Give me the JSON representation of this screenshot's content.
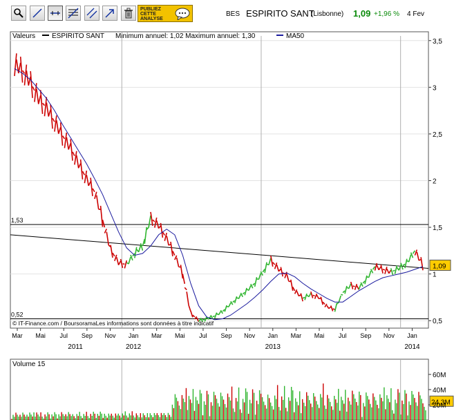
{
  "toolbar": {
    "tools": [
      "zoom-tool",
      "draw-line-tool",
      "horizontal-line-tool",
      "fibonacci-tool",
      "parallel-lines-tool",
      "arrow-tool",
      "delete-tool"
    ],
    "publish_label": "PUBLIEZ\nCETTE\nANALYSE"
  },
  "quote": {
    "ticker": "BES",
    "name": "ESPIRITO SANT",
    "market": "(Lisbonne)",
    "price": "1,09",
    "change": "+1,96 %",
    "date": "4 Fev",
    "change_color": "#0a8a0a"
  },
  "chart_data": {
    "type": "line",
    "legend_items": [
      "Valeurs",
      "ESPIRITO SANT",
      "Minimum annuel: 1,02 Maximum annuel: 1,30",
      "MA50"
    ],
    "legend_placement": "top-left",
    "series": [
      {
        "name": "ESPIRITO SANT",
        "color": "#cc0000",
        "values": [
          3.25,
          3.18,
          3.05,
          2.88,
          2.78,
          2.63,
          2.48,
          2.35,
          2.18,
          2.02,
          1.88,
          1.58,
          1.26,
          1.12,
          1.1,
          1.22,
          1.3,
          1.6,
          1.52,
          1.38,
          1.2,
          1.0,
          0.58,
          0.5,
          0.52,
          0.55,
          0.6,
          0.68,
          0.75,
          0.82,
          0.9,
          1.02,
          1.15,
          1.05,
          0.98,
          0.82,
          0.74,
          0.78,
          0.75,
          0.65,
          0.62,
          0.8,
          0.88,
          0.85,
          0.95,
          1.08,
          1.05,
          1.02,
          1.06,
          1.12,
          1.25,
          1.09
        ]
      },
      {
        "name": "MA50",
        "color": "#1a1a9e",
        "values": [
          3.2,
          3.15,
          3.08,
          2.98,
          2.88,
          2.75,
          2.6,
          2.46,
          2.32,
          2.18,
          2.02,
          1.85,
          1.65,
          1.45,
          1.28,
          1.2,
          1.22,
          1.3,
          1.42,
          1.48,
          1.42,
          1.2,
          0.9,
          0.66,
          0.54,
          0.51,
          0.52,
          0.56,
          0.62,
          0.68,
          0.75,
          0.83,
          0.92,
          1.0,
          1.01,
          0.97,
          0.9,
          0.84,
          0.79,
          0.74,
          0.7,
          0.7,
          0.76,
          0.82,
          0.87,
          0.92,
          0.96,
          0.98,
          1.0,
          1.02,
          1.05,
          1.08
        ]
      }
    ],
    "horizontal_levels": [
      {
        "label": "1,53",
        "value": 1.53
      },
      {
        "label": "0,52",
        "value": 0.52
      }
    ],
    "trendline": {
      "from": 1.42,
      "to": 1.06
    },
    "y_ticks": [
      "0,5",
      "1",
      "1,5",
      "2",
      "2,5",
      "3",
      "3,5"
    ],
    "y_tick_values": [
      0.5,
      1,
      1.5,
      2,
      2.5,
      3,
      3.5
    ],
    "ylim": [
      0.42,
      3.55
    ],
    "x_ticks": [
      "Mar",
      "Mai",
      "Jul",
      "Sep",
      "Nov",
      "Jan",
      "Mar",
      "Mai",
      "Jul",
      "Sep",
      "Nov",
      "Jan",
      "Mar",
      "Mai",
      "Jul",
      "Sep",
      "Nov",
      "Jan"
    ],
    "years": [
      "2011",
      "2012",
      "2013",
      "2014"
    ],
    "last_price_label": "1,09",
    "last_price_color": "#ffcc00",
    "footnote": "© IT-Finance.com / BoursoramaLes informations sont données à titre indicatif",
    "volume": {
      "label": "Volume 15",
      "ticks": [
        "60M",
        "40M",
        "20M"
      ],
      "tick_values": [
        60,
        40,
        20
      ],
      "ylim": [
        0,
        80
      ],
      "last_label": "24,3M",
      "last_color": "#ffcc00"
    },
    "grid": true
  }
}
